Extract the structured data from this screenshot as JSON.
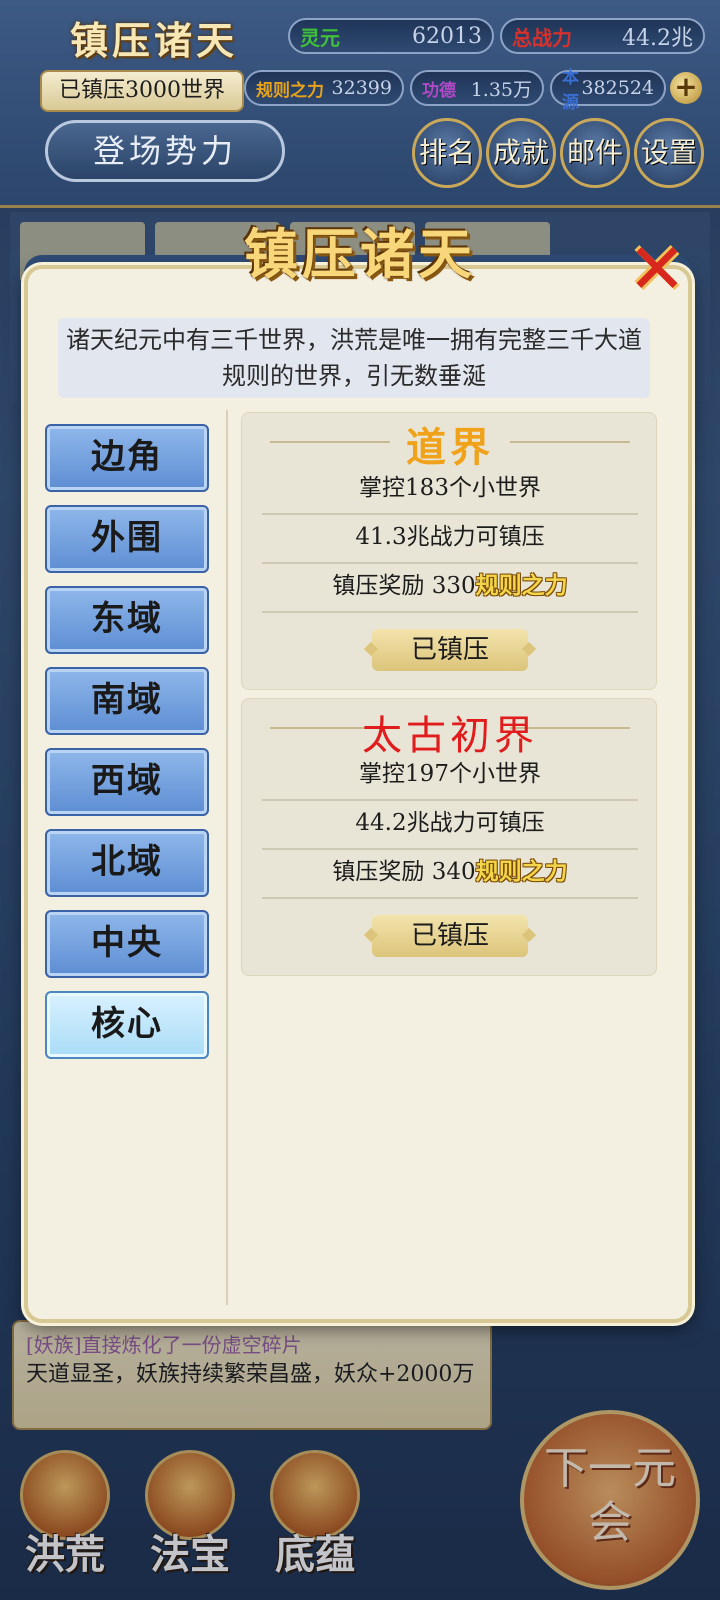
{
  "hud": {
    "title": "镇压诸天",
    "stats": [
      {
        "label": "灵元",
        "value": "62013",
        "color": "#3fbf3a"
      },
      {
        "label": "总战力",
        "value": "44.2兆",
        "color": "#d8302a"
      },
      {
        "label": "规则之力",
        "value": "32399",
        "color": "#e8a21a"
      },
      {
        "label": "功德",
        "value": "1.35万",
        "color": "#b04ac8"
      },
      {
        "label": "本源",
        "value": "382524",
        "color": "#3a6ed0"
      }
    ],
    "suppressed_count": "已镇压3000世界",
    "plus": "+",
    "faction_button": "登场势力",
    "buttons": [
      "排名",
      "成就",
      "邮件",
      "设置"
    ]
  },
  "modal": {
    "title": "镇压诸天",
    "close": "✕",
    "intro": "诸天纪元中有三千世界，洪荒是唯一拥有完整三千大道规则的世界，引无数垂涎",
    "regions": [
      "边角",
      "外围",
      "东域",
      "南域",
      "西域",
      "北域",
      "中央",
      "核心"
    ],
    "active_region": "核心",
    "realms": [
      {
        "name": "道界",
        "name_color": "#f0a21a",
        "control": "掌控183个小世界",
        "power": "41.3兆战力可镇压",
        "reward_prefix": "镇压奖励 330",
        "reward_name": "规则之力",
        "status": "已镇压"
      },
      {
        "name": "太古初界",
        "name_color": "#e01c1c",
        "control": "掌控197个小世界",
        "power": "44.2兆战力可镇压",
        "reward_prefix": "镇压奖励 340",
        "reward_name": "规则之力",
        "status": "已镇压"
      }
    ]
  },
  "log": {
    "top_line": "[妖族]直接炼化了一份虚空碎片",
    "message": "天道显圣，妖族持续繁荣昌盛，妖众+2000万"
  },
  "bottom_nav": {
    "items": [
      "洪荒",
      "法宝",
      "底蕴"
    ],
    "next_button": "下一元会"
  }
}
